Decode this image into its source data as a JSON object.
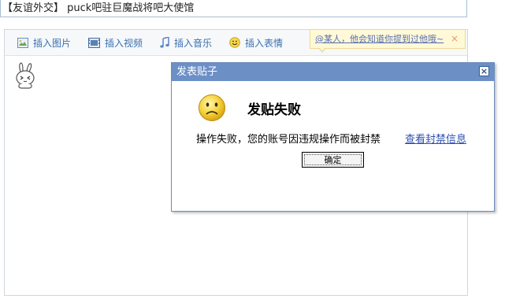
{
  "title_field": {
    "value": "【友谊外交】 puck吧驻巨魔战将吧大使馆"
  },
  "toolbar": {
    "insert_image": "插入图片",
    "insert_video": "插入视频",
    "insert_music": "插入音乐",
    "insert_emoji": "插入表情"
  },
  "mention_tip": {
    "text": "@某人，他会知道你提到过他哦~",
    "close": "×"
  },
  "dialog": {
    "title": "发表贴子",
    "close": "×",
    "heading": "发贴失败",
    "message": "操作失败，您的账号因违规操作而被封禁",
    "link": "查看封禁信息",
    "ok_label": "确定"
  },
  "colors": {
    "header_blue": "#6c8fc6",
    "link_blue": "#2e51b1",
    "tip_bg": "#fff9d8"
  }
}
